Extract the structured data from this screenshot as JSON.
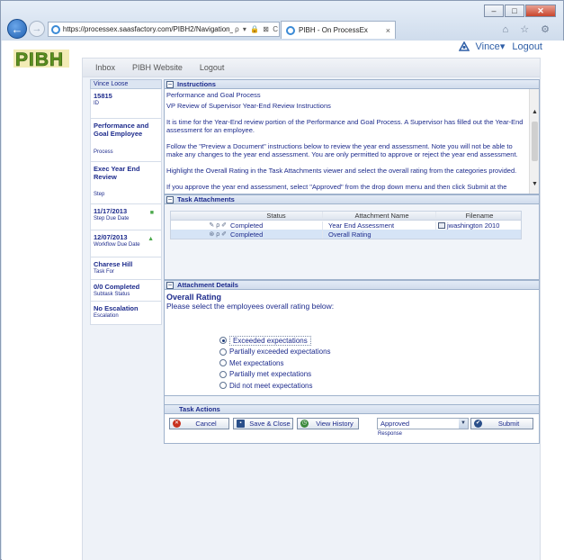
{
  "browser": {
    "url": "https://processex.saasfactory.com/PIBH2/Navigation_Co",
    "url_domain": "saasfactory.com",
    "tab_title": "PIBH - On ProcessEx",
    "tab_close": "×",
    "address_icons": "ρ ▾ 🔒 ⊠ C",
    "window_minimize": "–",
    "window_restore": "□",
    "window_close": "✕",
    "tool_icons": "⌂ ☆ ⚙"
  },
  "app": {
    "logo_text": "PIBH",
    "user_name": "Vince",
    "logout_label": "Logout",
    "nav": [
      "Inbox",
      "PIBH Website",
      "Logout"
    ]
  },
  "task_info": {
    "user": "Vince Loose",
    "items": [
      {
        "value": "15815",
        "label": "ID"
      },
      {
        "value": "Performance and Goal Employee",
        "label": "Process"
      },
      {
        "value": "Exec Year End Review",
        "label": "Step"
      },
      {
        "value": "11/17/2013",
        "label": "Step Due Date",
        "icon": "■"
      },
      {
        "value": "12/07/2013",
        "label": "Workflow Due Date",
        "icon": "▲"
      },
      {
        "value": "Charese Hill",
        "label": "Task For"
      },
      {
        "value": "0/0 Completed",
        "label": "Subtask Status"
      },
      {
        "value": "No Escalation",
        "label": "Escalation"
      }
    ]
  },
  "instructions": {
    "title": "Instructions",
    "paragraphs": [
      "Performance and Goal Process",
      "VP Review of Supervisor Year-End Review Instructions",
      "It is time for the Year-End review portion of the Performance and Goal Process.  A Supervisor has filled out the Year-End assessment for an employee.",
      "Follow the \"Preview a Document\" instructions below to review the year end assessment.  Note you will not be able to make any changes to the year end assessment.  You are only permitted to approve or reject the year end assessment.",
      "Highlight the Overall Rating in the Task Attachments viewer and select the overall rating from the categories provided.",
      "If you approve the year end assessment, select \"Approved\" from the drop down menu and then click Submit at the"
    ]
  },
  "attachments": {
    "title": "Task Attachments",
    "columns": [
      "Status",
      "Attachment Name",
      "Filename"
    ],
    "rows": [
      {
        "icons": "✎ ρ ✐",
        "status": "Completed",
        "name": "Year End Assessment",
        "file": "jwashington 2010"
      },
      {
        "icons": "⊛ ρ ✐",
        "status": "Completed",
        "name": "Overall Rating",
        "file": ""
      }
    ]
  },
  "details": {
    "title": "Attachment Details",
    "heading": "Overall Rating",
    "prompt": "Please select the employees overall rating below:",
    "options": [
      "Exceeded expectations",
      "Partially exceeded expectations",
      "Met expectations",
      "Partially met expectations",
      "Did not meet expectations"
    ],
    "selected_index": 0
  },
  "actions": {
    "title": "Task Actions",
    "cancel_label": "Cancel",
    "save_label": "Save & Close",
    "history_label": "View History",
    "submit_label": "Submit",
    "response_value": "Approved",
    "response_label": "Response"
  },
  "colors": {
    "text": "#1d2b8c",
    "link": "#2f5fa7",
    "logo_green": "#5a8f1e",
    "logo_yellow": "#d9c62c"
  }
}
